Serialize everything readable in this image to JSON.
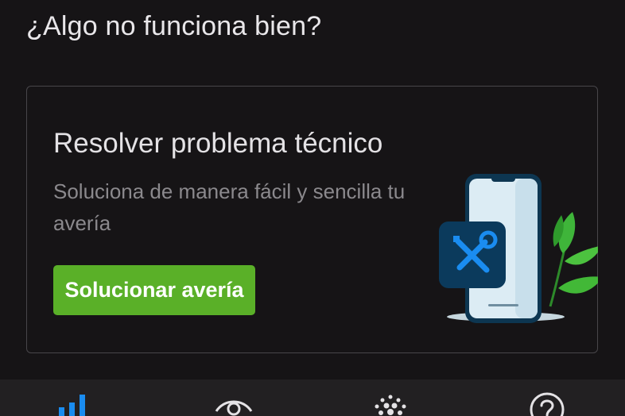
{
  "section": {
    "title": "¿Algo no funciona bien?"
  },
  "card": {
    "title": "Resolver problema técnico",
    "description": "Soluciona de manera fácil y sencilla tu avería",
    "button_label": "Solucionar avería",
    "illustration": "phone-with-tools-and-leaves"
  },
  "bottom_nav": {
    "items": [
      {
        "icon": "signal-bars-icon",
        "active": true
      },
      {
        "icon": "eye-icon",
        "active": false
      },
      {
        "icon": "dots-burst-icon",
        "active": false
      },
      {
        "icon": "help-circle-icon",
        "active": false
      }
    ]
  },
  "colors": {
    "background": "#161416",
    "accent_green": "#5ab028",
    "active_blue": "#1a8cf0",
    "tool_badge": "#0b3a5c"
  }
}
